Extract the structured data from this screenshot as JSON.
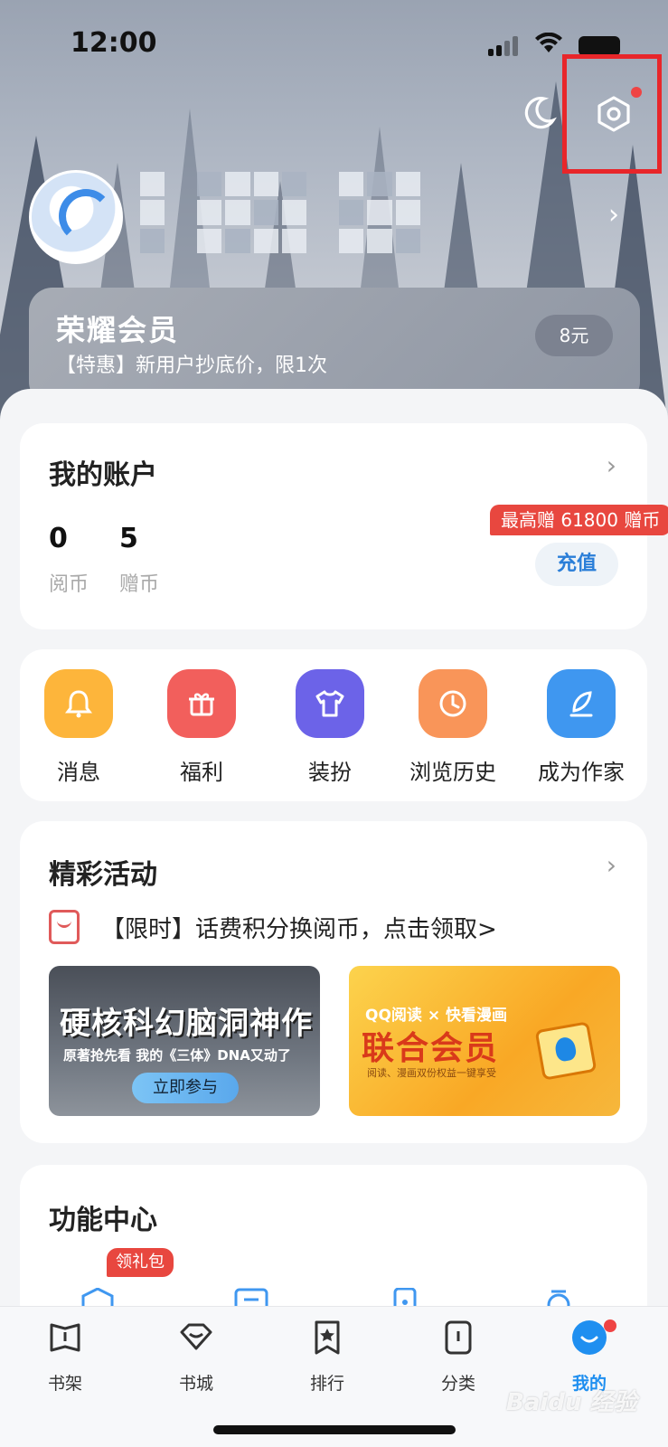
{
  "status_bar": {
    "time": "12:00"
  },
  "vip": {
    "title": "荣耀会员",
    "subtitle": "【特惠】新用户抄底价，限1次",
    "price": "8元"
  },
  "account": {
    "title": "我的账户",
    "coins_value": "0",
    "coins_label": "阅币",
    "gift_value": "5",
    "gift_label": "赠币",
    "bonus_tag": "最高赠 61800 赠币",
    "recharge_label": "充值"
  },
  "quick_actions": [
    {
      "label": "消息",
      "icon": "bell-icon",
      "color": "#fdb53b"
    },
    {
      "label": "福利",
      "icon": "gift-icon",
      "color": "#f25f5c"
    },
    {
      "label": "装扮",
      "icon": "shirt-icon",
      "color": "#6c63e8"
    },
    {
      "label": "浏览历史",
      "icon": "clock-icon",
      "color": "#f99559"
    },
    {
      "label": "成为作家",
      "icon": "feather-icon",
      "color": "#3f97f0"
    }
  ],
  "activities": {
    "title": "精彩活动",
    "promo_text": "【限时】话费积分换阅币，点击领取>",
    "banner1": {
      "title": "硬核科幻脑洞神作",
      "subtitle": "原著抢先看 我的《三体》DNA又动了",
      "button": "立即参与"
    },
    "banner2": {
      "top": "QQ阅读 × 快看漫画",
      "title": "联合会员",
      "subtitle": "阅读、漫画双份权益一键享受"
    }
  },
  "function_center": {
    "title": "功能中心",
    "tag": "领礼包"
  },
  "tabs": [
    {
      "label": "书架",
      "icon": "bookshelf-icon"
    },
    {
      "label": "书城",
      "icon": "bookstore-icon"
    },
    {
      "label": "排行",
      "icon": "ranking-icon"
    },
    {
      "label": "分类",
      "icon": "category-icon"
    },
    {
      "label": "我的",
      "icon": "profile-icon",
      "active": true
    }
  ],
  "watermark": "Baidu 经验"
}
